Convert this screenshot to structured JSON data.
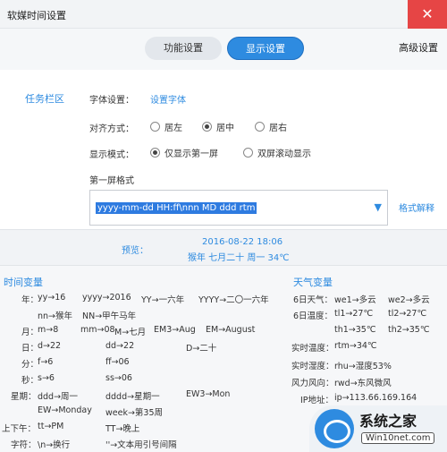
{
  "window": {
    "title": "软媒时间设置",
    "close_glyph": "✕"
  },
  "tabs": {
    "func": "功能设置",
    "display": "显示设置",
    "advanced": "高级设置"
  },
  "side": {
    "taskbar": "任务栏区"
  },
  "font": {
    "label": "字体设置：",
    "link": "设置字体"
  },
  "align": {
    "label": "对齐方式：",
    "left": "居左",
    "center": "居中",
    "right": "居右",
    "selected": "center"
  },
  "mode": {
    "label": "显示模式：",
    "single": "仅显示第一屏",
    "double": "双屏滚动显示",
    "selected": "single"
  },
  "first_screen": {
    "label": "第一屏格式",
    "value": "yyyy-mm-dd HH:ff\\nnn MD ddd rtm",
    "help": "格式解释"
  },
  "preview": {
    "label": "预览：",
    "line1": "2016-08-22 18:06",
    "line2": "猴年 七月二十 周一 34℃"
  },
  "time_vars": {
    "title": "时间变量",
    "year": {
      "label": "年：",
      "a": "yy→16",
      "b": "yyyy→2016",
      "c": "YY→一六年",
      "d": "YYYY→二〇一六年",
      "e": "nn→猴年",
      "f": "NN→甲午马年"
    },
    "month": {
      "label": "月：",
      "a": "m→8",
      "b": "mm→08",
      "c": "M→七月",
      "d": "EM3→Aug",
      "e": "EM→August"
    },
    "day": {
      "label": "日：",
      "a": "d→22",
      "b": "dd→22",
      "c": "D→二十"
    },
    "minute": {
      "label": "分：",
      "a": "f→6",
      "b": "ff→06"
    },
    "second": {
      "label": "秒：",
      "a": "s→6",
      "b": "ss→06"
    },
    "week": {
      "label": "星期：",
      "a": "ddd→周一",
      "b": "dddd→星期一",
      "c": "EW3→Mon",
      "d": "EW→Monday",
      "e": "week→第35周"
    },
    "ampm": {
      "label": "上下午：",
      "a": "tt→PM",
      "b": "TT→晚上"
    },
    "char": {
      "label": "字符：",
      "a": "\\n→换行",
      "b": "''→文本用引号间隔"
    }
  },
  "weather_vars": {
    "title": "天气变量",
    "w6_label": "6日天气：",
    "w6_a": "we1→多云",
    "w6_b": "we2→多云",
    "t6_label": "6日温度：",
    "t6_a": "tl1→27℃",
    "t6_b": "tl2→27℃",
    "t6_c": "th1→35℃",
    "t6_d": "th2→35℃",
    "rt_label": "实时温度：",
    "rt_a": "rtm→34℃",
    "rh_label": "实时湿度：",
    "rh_a": "rhu→湿度53%",
    "wind_label": "风力风向：",
    "wind_a": "rwd→东风微风",
    "ip_label": "IP地址：",
    "ip_a": "ip→113.66.169.164"
  },
  "watermark": {
    "text1": "系统之家",
    "text2": "Win10net.com"
  }
}
